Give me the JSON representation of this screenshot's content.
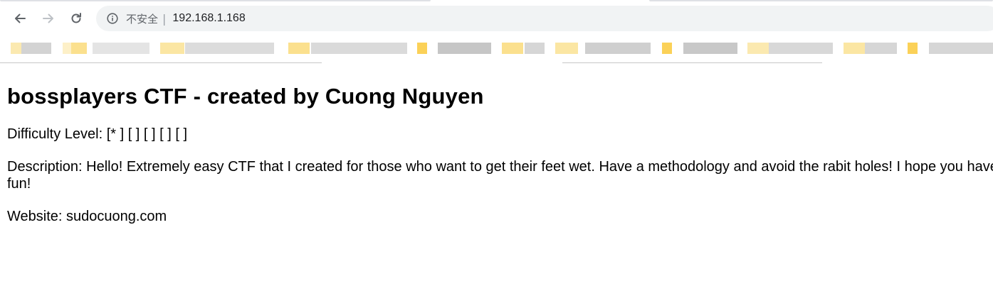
{
  "browser": {
    "security_label": "不安全",
    "separator": "|",
    "url": "192.168.1.168",
    "colors": {
      "omnibox_bg": "#f1f3f4",
      "icon": "#5f6368",
      "bookmark_folder": "#fbd158",
      "bookmark_blur": "#d5d5d5"
    }
  },
  "page": {
    "title": "bossplayers CTF - created by Cuong Nguyen",
    "difficulty": "Difficulty Level: [* ] [ ] [ ] [ ] [ ]",
    "description": "Description: Hello! Extremely easy CTF that I created for those who want to get their feet wet. Have a methodology and avoid the rabit holes! I hope you have fun!",
    "website": "Website: sudocuong.com"
  }
}
